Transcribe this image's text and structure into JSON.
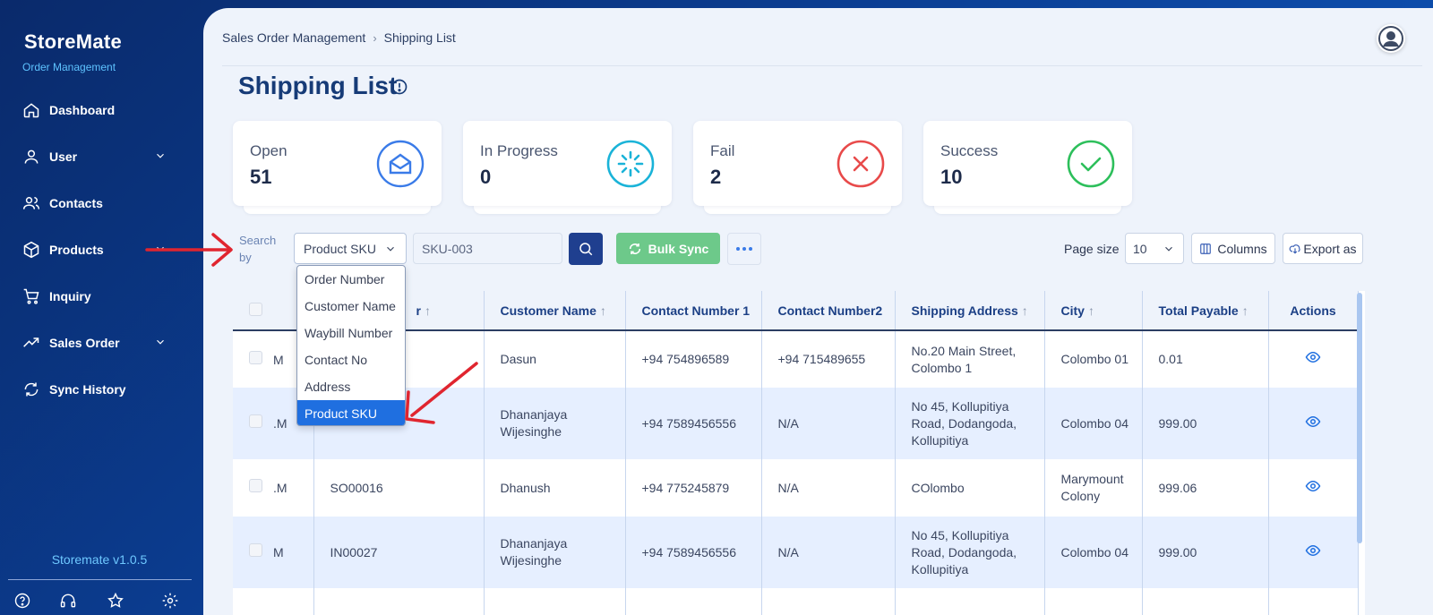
{
  "sidebar": {
    "brand": "StoreMate",
    "subtitle": "Order Management",
    "items": [
      {
        "label": "Dashboard",
        "icon": "home-icon",
        "has_chevron": false
      },
      {
        "label": "User",
        "icon": "user-icon",
        "has_chevron": true
      },
      {
        "label": "Contacts",
        "icon": "contacts-icon",
        "has_chevron": false
      },
      {
        "label": "Products",
        "icon": "box-icon",
        "has_chevron": true
      },
      {
        "label": "Inquiry",
        "icon": "cart-icon",
        "has_chevron": false
      },
      {
        "label": "Sales Order",
        "icon": "trend-icon",
        "has_chevron": true
      },
      {
        "label": "Sync History",
        "icon": "sync-icon",
        "has_chevron": false
      }
    ],
    "version": "Storemate v1.0.5",
    "bottom_icons": [
      "help-icon",
      "headset-icon",
      "star-icon",
      "gear-icon"
    ]
  },
  "header": {
    "breadcrumb": [
      "Sales Order Management",
      "Shipping List"
    ],
    "page_title": "Shipping List"
  },
  "cards": [
    {
      "label": "Open",
      "value": "51",
      "color": "#3a7be8",
      "icon": "envelope-open-icon"
    },
    {
      "label": "In Progress",
      "value": "0",
      "color": "#1ab3d8",
      "icon": "spinner-icon"
    },
    {
      "label": "Fail",
      "value": "2",
      "color": "#e84a4a",
      "icon": "x-circle-icon"
    },
    {
      "label": "Success",
      "value": "10",
      "color": "#2dbf5b",
      "icon": "check-circle-icon"
    }
  ],
  "toolbar": {
    "search_by_label": "Search by",
    "search_by_selected": "Product SKU",
    "search_value": "SKU-003",
    "bulk_sync_label": "Bulk Sync",
    "page_size_label": "Page size",
    "page_size_value": "10",
    "columns_label": "Columns",
    "export_label": "Export as"
  },
  "dropdown": {
    "options": [
      "Order Number",
      "Customer Name",
      "Waybill Number",
      "Contact No",
      "Address",
      "Product SKU"
    ],
    "selected_index": 5
  },
  "table": {
    "columns": [
      "",
      "Order Number",
      "Customer Name",
      "Contact Number 1",
      "Contact Number2",
      "Shipping Address",
      "City",
      "Total Payable",
      "Actions"
    ],
    "order_col_visible": "r",
    "rows": [
      {
        "prefix": "M",
        "order": "",
        "customer": "Dasun",
        "contact1": "+94 754896589",
        "contact2": "+94 715489655",
        "address": "No.20 Main Street, Colombo 1",
        "city": "Colombo 01",
        "total": "0.01"
      },
      {
        "prefix": ".M",
        "order": "",
        "customer": "Dhananjaya Wijesinghe",
        "contact1": "+94 7589456556",
        "contact2": "N/A",
        "address": "No 45, Kollupitiya Road, Dodangoda, Kollupitiya",
        "city": "Colombo 04",
        "total": "999.00"
      },
      {
        "prefix": ".M",
        "order": "SO00016",
        "customer": "Dhanush",
        "contact1": "+94 775245879",
        "contact2": "N/A",
        "address": "COlombo",
        "city": "Marymount Colony",
        "total": "999.06"
      },
      {
        "prefix": "M",
        "order": "IN00027",
        "customer": "Dhananjaya Wijesinghe",
        "contact1": "+94 7589456556",
        "contact2": "N/A",
        "address": "No 45, Kollupitiya Road, Dodangoda, Kollupitiya",
        "city": "Colombo 04",
        "total": "999.00"
      }
    ]
  },
  "colors": {
    "accent": "#1f3f8f",
    "bulk": "#6dc98a",
    "annotation": "#e0252f"
  }
}
